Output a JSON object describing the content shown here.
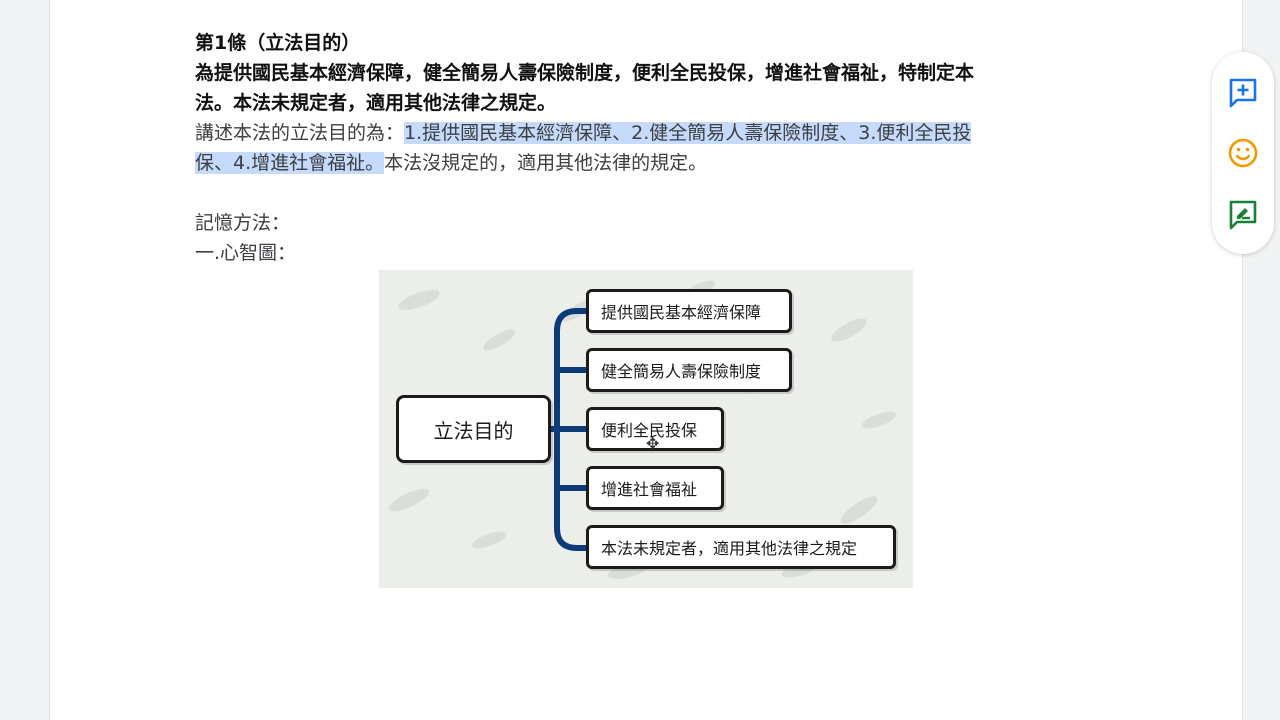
{
  "document": {
    "lines": [
      {
        "parts": [
          {
            "text": "第1條（立法目的）",
            "style": "bold"
          }
        ]
      },
      {
        "parts": [
          {
            "text": "為提供國民基本經濟保障，健全簡易人壽保險制度，便利全民投保，增進社會福祉，特制定本",
            "style": "bold"
          }
        ]
      },
      {
        "parts": [
          {
            "text": "法。本法未規定者，適用其他法律之規定。",
            "style": "bold"
          }
        ]
      },
      {
        "parts": [
          {
            "text": "講述本法的立法目的為：",
            "style": "normal"
          },
          {
            "text": "1.提供國民基本經濟保障、2.健全簡易人壽保險制度、3.便利全民投",
            "style": "highlight"
          }
        ]
      },
      {
        "parts": [
          {
            "text": "保、4.增進社會福祉。",
            "style": "highlight"
          },
          {
            "text": "本法沒規定的，適用其他法律的規定。",
            "style": "normal"
          }
        ]
      },
      {
        "parts": []
      },
      {
        "parts": [
          {
            "text": "記憶方法：",
            "style": "normal"
          }
        ]
      },
      {
        "parts": [
          {
            "text": "一.心智圖：",
            "style": "normal"
          }
        ]
      }
    ]
  },
  "mindmap": {
    "root": "立法目的",
    "branches": [
      "提供國民基本經濟保障",
      "健全簡易人壽保險制度",
      "便利全民投保",
      "增進社會福祉",
      "本法未規定者，適用其他法律之規定"
    ],
    "colors": {
      "connector": "#0d3b7a",
      "border": "#1b1b1b",
      "background": "#eceeea"
    }
  },
  "toolbar": {
    "buttons": [
      {
        "name": "add-comment",
        "icon": "add-comment-icon",
        "color": "#1a73e8"
      },
      {
        "name": "emoji-reaction",
        "icon": "emoji-icon",
        "color": "#f29900"
      },
      {
        "name": "suggest-edits",
        "icon": "suggest-edit-icon",
        "color": "#188038"
      }
    ]
  }
}
